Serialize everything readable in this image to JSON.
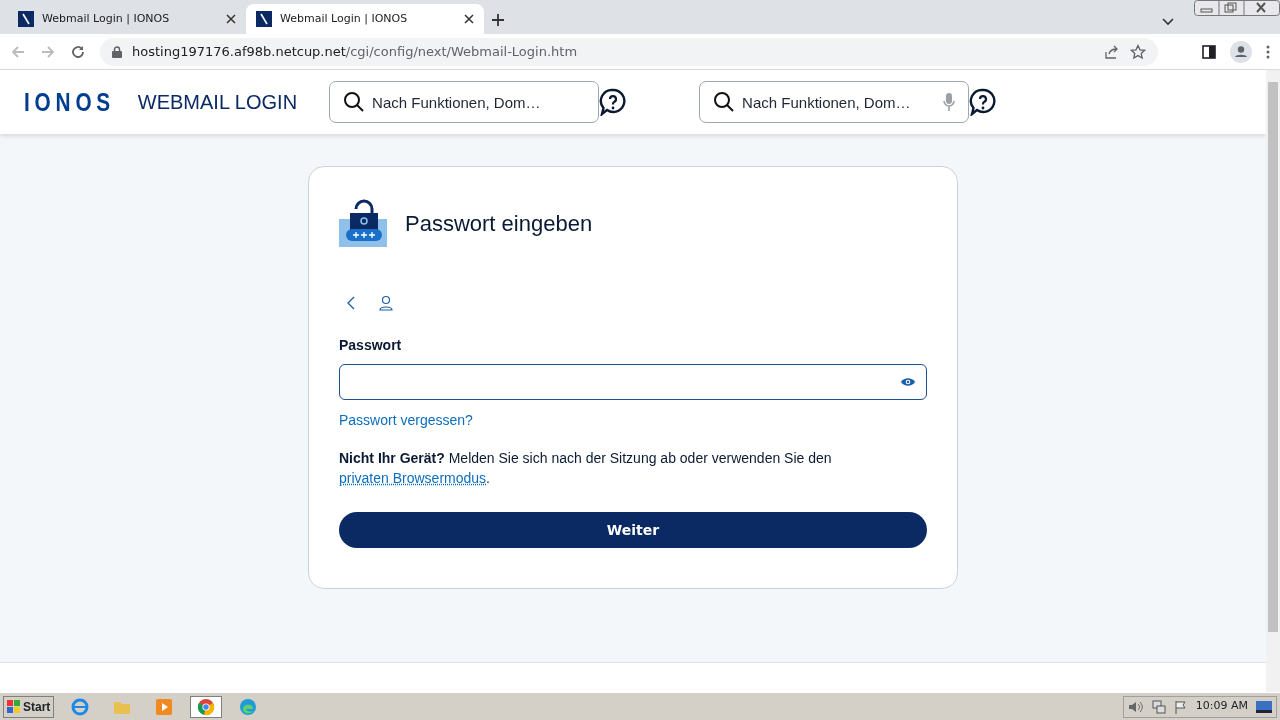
{
  "browser": {
    "tabs": [
      {
        "title": "Webmail Login | IONOS",
        "selected": false
      },
      {
        "title": "Webmail Login | IONOS",
        "selected": true
      }
    ],
    "url_host": "hosting197176.af98b.netcup.net",
    "url_path": "/cgi/config/next/Webmail-Login.htm"
  },
  "header": {
    "logo": "IONOS",
    "title": "WEBMAIL LOGIN",
    "searches": [
      {
        "placeholder": "Nach Funktionen, Dom…",
        "mic": false
      },
      {
        "placeholder": "Nach Funktionen, Dom…",
        "mic": true
      }
    ]
  },
  "card": {
    "heading": "Passwort eingeben",
    "field_label": "Passwort",
    "forgot_link": "Passwort vergessen?",
    "notice": "**Nicht Ihr Gerät?** Melden Sie sich nach der Sitzung ab oder verwenden Sie den ",
    "notice_link": "privaten Browsermodus",
    "notice_end": ".",
    "submit": "Weiter"
  },
  "taskbar": {
    "start": "Start",
    "clock": "10:09 AM"
  }
}
